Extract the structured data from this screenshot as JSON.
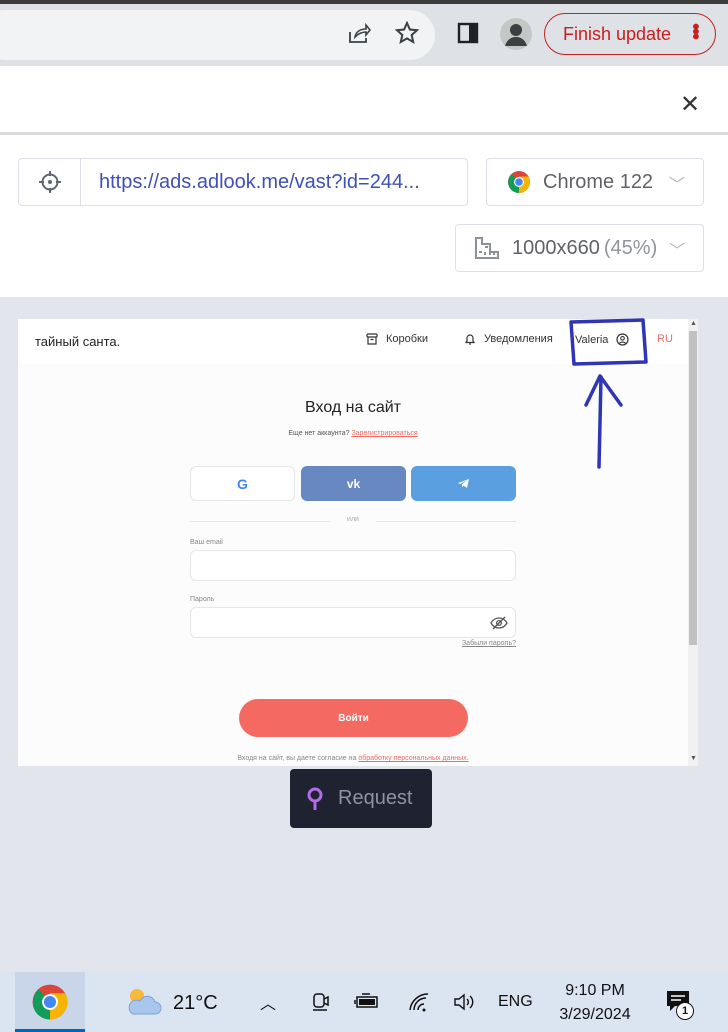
{
  "browser": {
    "finish_update_label": "Finish update"
  },
  "panel": {
    "url": "https://ads.adlook.me/vast?id=244...",
    "browser_select": "Chrome 122",
    "size_select": "1000x660",
    "size_percent": "(45%)"
  },
  "site": {
    "logo": "тайный санта.",
    "nav_boxes": "Коробки",
    "nav_notifications": "Уведомления",
    "user_name": "Valeria",
    "lang": "RU",
    "title": "Вход на сайт",
    "no_account": "Еще нет аккаунта?",
    "register_link": "Зарегистрироваться",
    "google_label": "G",
    "vk_label": "vk",
    "or_label": "или",
    "email_label": "Ваш email",
    "password_label": "Пароль",
    "forgot_label": "Забыли пароль?",
    "login_button": "Войти",
    "consent_text": "Входя на сайт, вы даете согласие на",
    "consent_link": "обработку персональных данных."
  },
  "request_button": "Request",
  "taskbar": {
    "temperature": "21°C",
    "language": "ENG",
    "time": "9:10 PM",
    "date": "3/29/2024",
    "notification_count": "1"
  },
  "colors": {
    "finish_update": "#c5221f",
    "url_text": "#3f51b5",
    "site_accent": "#f06b63",
    "vk_button": "#6788c0",
    "telegram_button": "#5aa0e0",
    "request_bg": "#1f2230",
    "annotation": "#2f35b5"
  }
}
